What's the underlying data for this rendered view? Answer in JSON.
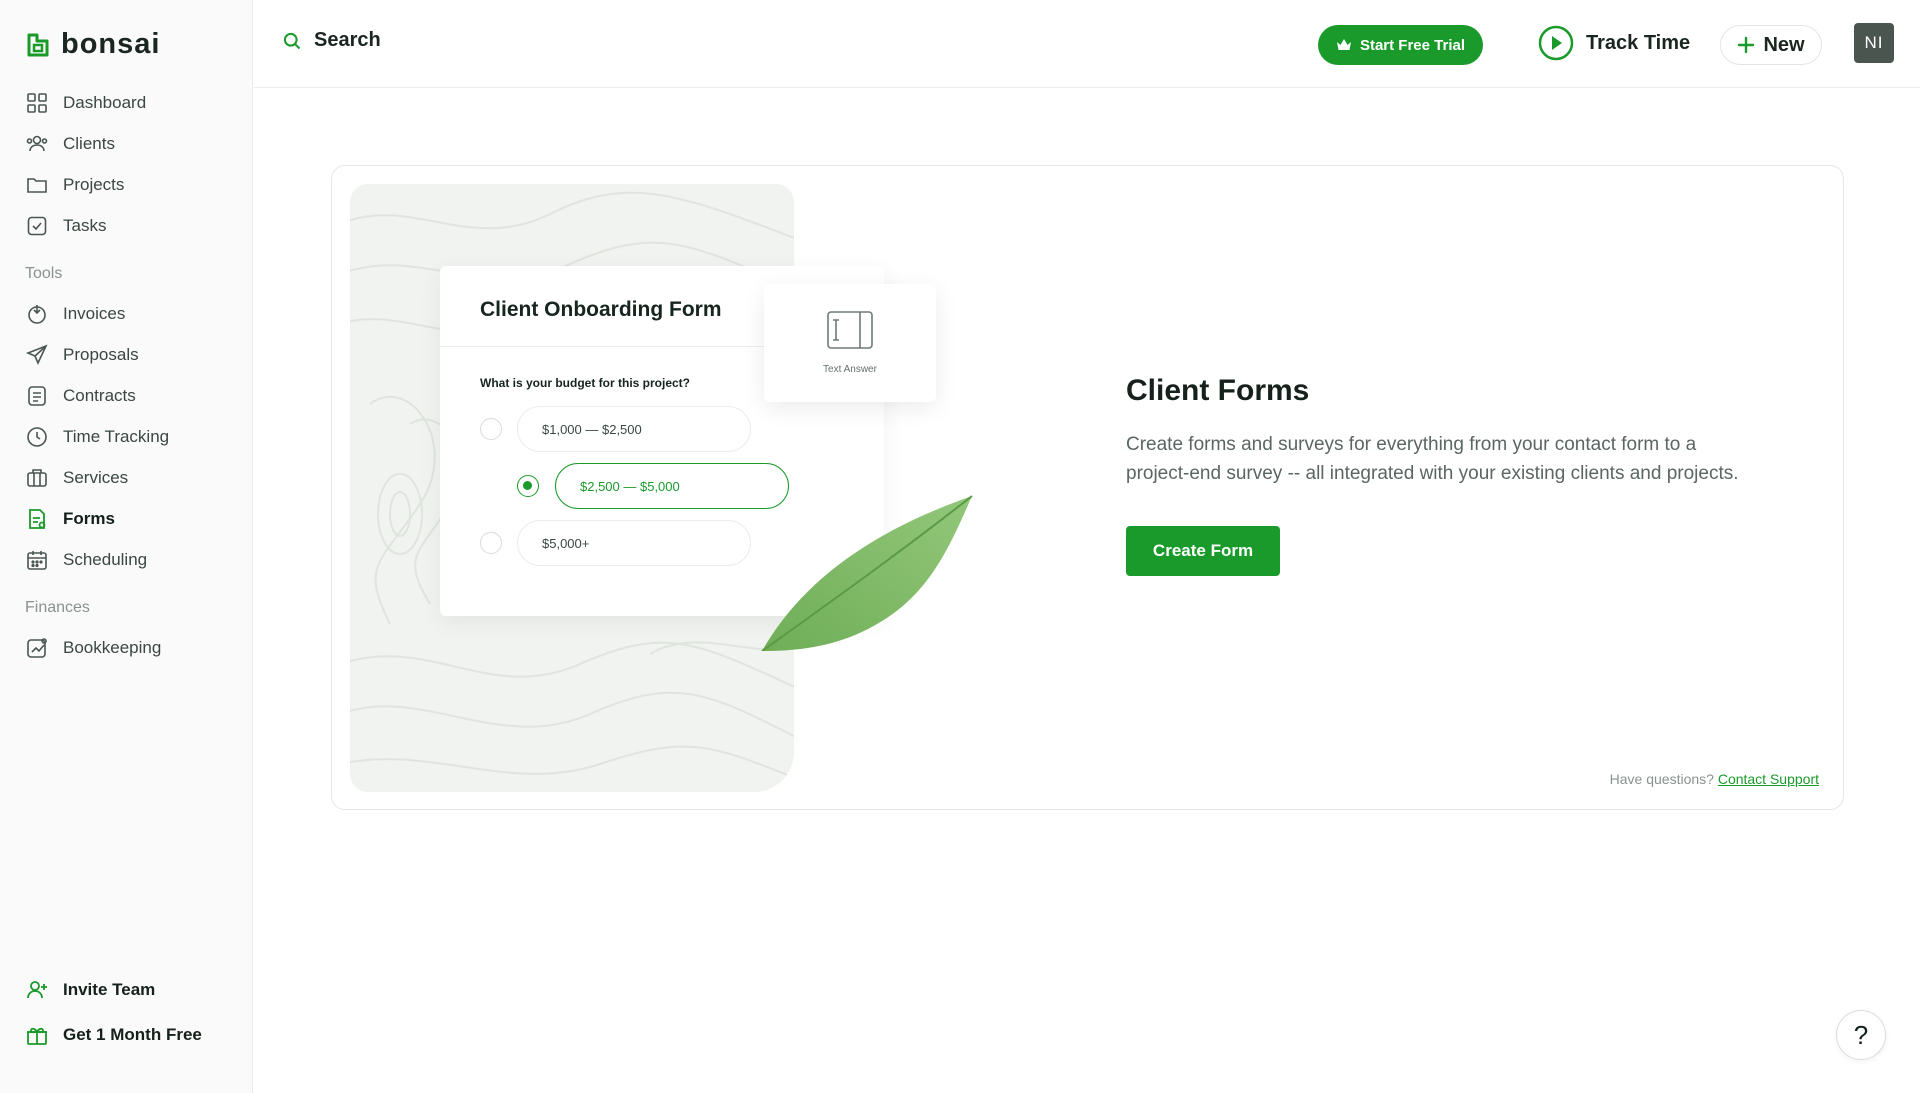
{
  "brand": {
    "name": "bonsai",
    "accent": "#1a9a2a"
  },
  "sidebar": {
    "main_items": [
      {
        "label": "Dashboard",
        "icon": "dashboard-icon"
      },
      {
        "label": "Clients",
        "icon": "clients-icon"
      },
      {
        "label": "Projects",
        "icon": "folder-icon"
      },
      {
        "label": "Tasks",
        "icon": "checkbox-icon"
      }
    ],
    "tools_label": "Tools",
    "tools_items": [
      {
        "label": "Invoices",
        "icon": "invoice-icon"
      },
      {
        "label": "Proposals",
        "icon": "send-icon"
      },
      {
        "label": "Contracts",
        "icon": "contract-icon"
      },
      {
        "label": "Time Tracking",
        "icon": "clock-icon"
      },
      {
        "label": "Services",
        "icon": "services-icon"
      },
      {
        "label": "Forms",
        "icon": "forms-icon",
        "active": true
      },
      {
        "label": "Scheduling",
        "icon": "calendar-icon"
      }
    ],
    "finances_label": "Finances",
    "finances_items": [
      {
        "label": "Bookkeeping",
        "icon": "bookkeeping-icon"
      }
    ],
    "bottom_items": [
      {
        "label": "Invite Team",
        "icon": "add-user-icon"
      },
      {
        "label": "Get 1 Month Free",
        "icon": "gift-icon"
      }
    ]
  },
  "topbar": {
    "search_label": "Search",
    "trial_label": "Start Free Trial",
    "track_time_label": "Track Time",
    "new_label": "New",
    "avatar_initials": "NI"
  },
  "illustration": {
    "form_title": "Client Onboarding Form",
    "question": "What is your budget for this project?",
    "options": [
      {
        "label": "$1,000 — $2,500",
        "selected": false
      },
      {
        "label": "$2,500 — $5,000",
        "selected": true
      },
      {
        "label": "$5,000+",
        "selected": false
      }
    ],
    "text_answer_label": "Text Answer"
  },
  "main": {
    "title": "Client Forms",
    "description": "Create forms and surveys for everything from your contact form to a project-end survey -- all integrated with your existing clients and projects.",
    "create_button": "Create Form",
    "support_prefix": "Have questions?",
    "support_link": "Contact Support"
  },
  "help_label": "?"
}
